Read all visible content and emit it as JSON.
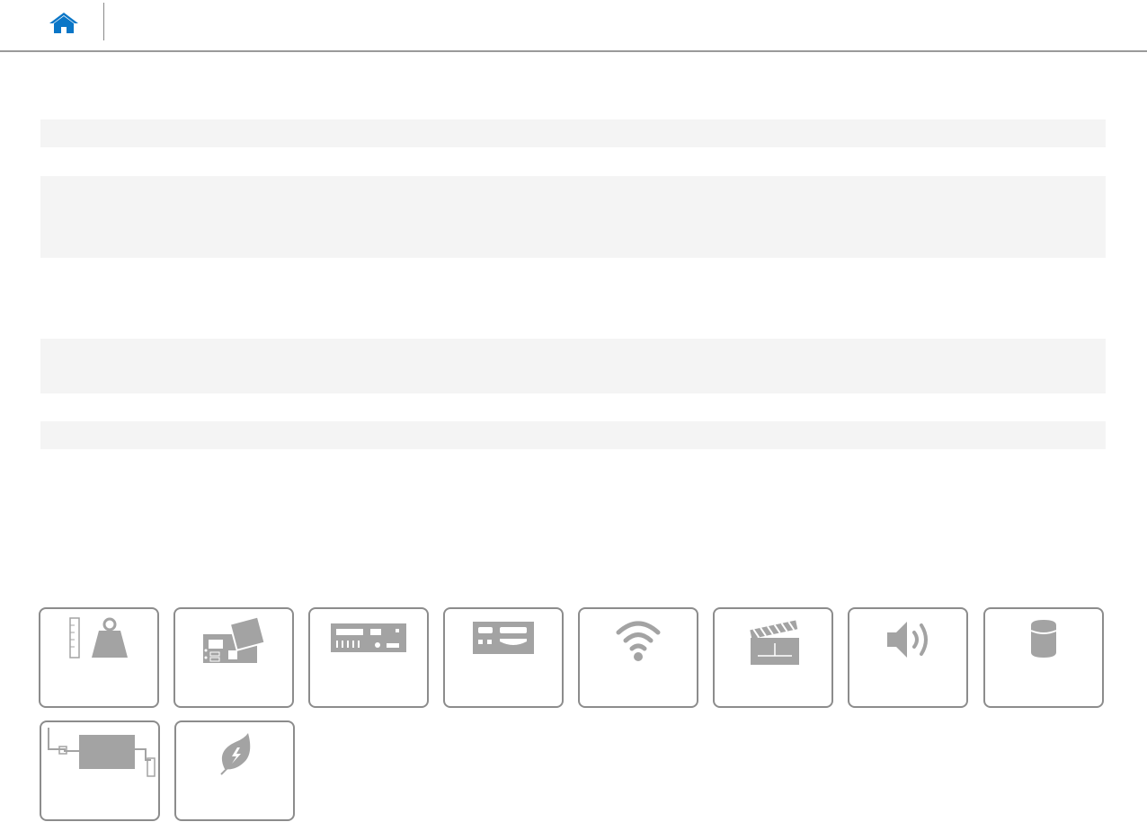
{
  "header": {
    "home_icon": "home-icon",
    "accent_color": "#0a76c7"
  },
  "colors": {
    "tile_border": "#8c8c8c",
    "icon_gray": "#a3a3a3",
    "bar_background": "#f4f4f4",
    "divider": "#9a9a9a"
  },
  "tiles": [
    {
      "icon": "weight-and-dimensions-icon"
    },
    {
      "icon": "system-board-icon"
    },
    {
      "icon": "rear-ports-icon"
    },
    {
      "icon": "front-ports-icon"
    },
    {
      "icon": "wireless-icon"
    },
    {
      "icon": "video-icon"
    },
    {
      "icon": "audio-icon"
    },
    {
      "icon": "storage-icon"
    },
    {
      "icon": "power-adapter-icon"
    },
    {
      "icon": "environmental-icon"
    }
  ]
}
